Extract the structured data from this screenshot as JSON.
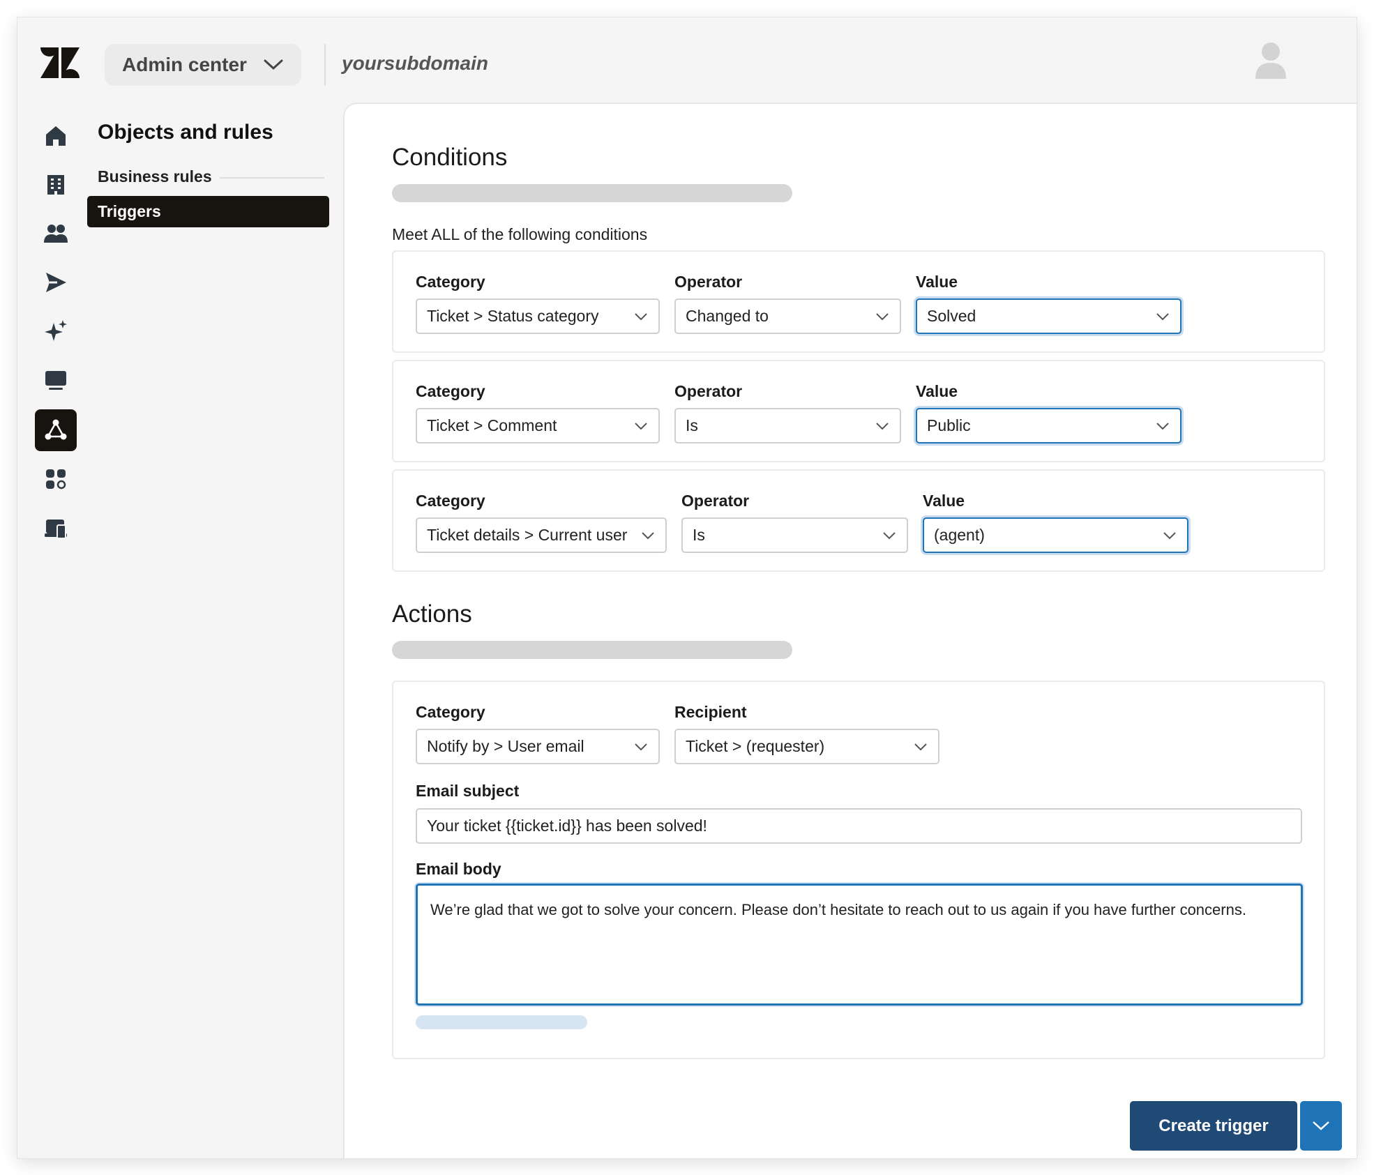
{
  "header": {
    "product_switcher": "Admin center",
    "subdomain": "yoursubdomain"
  },
  "icon_rail": [
    {
      "icon": "home-icon",
      "active": false
    },
    {
      "icon": "building-icon",
      "active": false
    },
    {
      "icon": "people-icon",
      "active": false
    },
    {
      "icon": "send-icon",
      "active": false
    },
    {
      "icon": "sparkle-icon",
      "active": false
    },
    {
      "icon": "monitor-icon",
      "active": false
    },
    {
      "icon": "objects-rules-icon",
      "active": true
    },
    {
      "icon": "apps-icon",
      "active": false
    },
    {
      "icon": "devices-icon",
      "active": false
    }
  ],
  "nav": {
    "title": "Objects and rules",
    "section": "Business rules",
    "active_item": "Triggers"
  },
  "conditions": {
    "title": "Conditions",
    "meet_label": "Meet ALL of the following conditions",
    "rows": [
      {
        "category_label": "Category",
        "category": "Ticket > Status category",
        "operator_label": "Operator",
        "operator": "Changed to",
        "value_label": "Value",
        "value": "Solved"
      },
      {
        "category_label": "Category",
        "category": "Ticket > Comment",
        "operator_label": "Operator",
        "operator": "Is",
        "value_label": "Value",
        "value": "Public"
      },
      {
        "category_label": "Category",
        "category": "Ticket details > Current user",
        "operator_label": "Operator",
        "operator": "Is",
        "value_label": "Value",
        "value": "(agent)"
      }
    ]
  },
  "actions": {
    "title": "Actions",
    "category_label": "Category",
    "category": "Notify by > User email",
    "recipient_label": "Recipient",
    "recipient": "Ticket > (requester)",
    "subject_label": "Email subject",
    "subject": "Your ticket {{ticket.id}} has been solved!",
    "body_label": "Email body",
    "body": "We’re glad that we got to solve your concern. Please don’t hesitate to reach out to us again if you have further concerns."
  },
  "footer": {
    "create_label": "Create trigger"
  },
  "colors": {
    "primary": "#1f4a76",
    "focus": "#1f73b7",
    "rail_active": "#17140f"
  }
}
